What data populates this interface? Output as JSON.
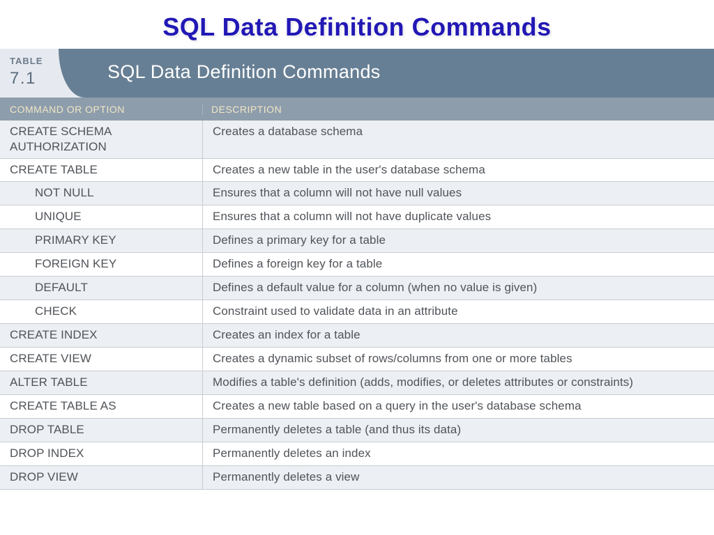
{
  "page_title": "SQL Data Definition Commands",
  "table_tag_label": "TABLE",
  "table_tag_number": "7.1",
  "table_title": "SQL Data Definition Commands",
  "columns": {
    "command": "COMMAND OR OPTION",
    "description": "DESCRIPTION"
  },
  "rows": [
    {
      "cmd": "CREATE SCHEMA AUTHORIZATION",
      "indent": false,
      "desc": "Creates a database schema"
    },
    {
      "cmd": "CREATE TABLE",
      "indent": false,
      "desc": "Creates a new table in the user's database schema"
    },
    {
      "cmd": "NOT NULL",
      "indent": true,
      "desc": "Ensures that a column will not have null values"
    },
    {
      "cmd": "UNIQUE",
      "indent": true,
      "desc": "Ensures that a column will not have duplicate values"
    },
    {
      "cmd": "PRIMARY KEY",
      "indent": true,
      "desc": "Defines a primary key for a table"
    },
    {
      "cmd": "FOREIGN KEY",
      "indent": true,
      "desc": "Defines a foreign key for a table"
    },
    {
      "cmd": "DEFAULT",
      "indent": true,
      "desc": "Defines a default value for a column (when no value is given)"
    },
    {
      "cmd": "CHECK",
      "indent": true,
      "desc": "Constraint used to validate data in an attribute"
    },
    {
      "cmd": "CREATE INDEX",
      "indent": false,
      "desc": "Creates an index for a table"
    },
    {
      "cmd": "CREATE VIEW",
      "indent": false,
      "desc": "Creates a dynamic subset of rows/columns from one or more tables"
    },
    {
      "cmd": "ALTER TABLE",
      "indent": false,
      "desc": "Modifies a table's definition (adds, modifies, or deletes attributes or constraints)"
    },
    {
      "cmd": "CREATE TABLE AS",
      "indent": false,
      "desc": "Creates a new table based on a query in the user's database schema"
    },
    {
      "cmd": "DROP TABLE",
      "indent": false,
      "desc": "Permanently deletes a table (and thus its data)"
    },
    {
      "cmd": "DROP INDEX",
      "indent": false,
      "desc": "Permanently deletes an index"
    },
    {
      "cmd": "DROP VIEW",
      "indent": false,
      "desc": "Permanently deletes a view"
    }
  ]
}
